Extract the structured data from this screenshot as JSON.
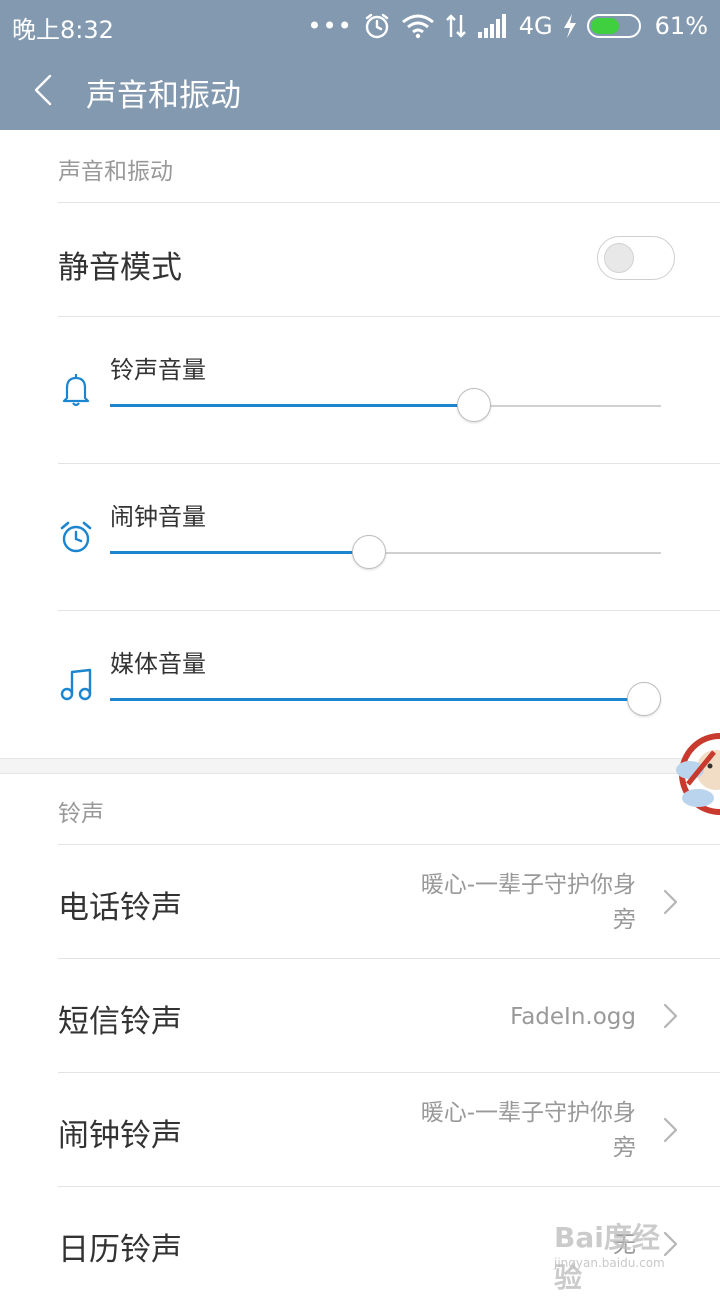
{
  "status_bar": {
    "time": "晚上8:32",
    "network": "4G",
    "battery": "61%",
    "battery_level": 0.61
  },
  "header": {
    "title": "声音和振动"
  },
  "sound_section": {
    "header": "声音和振动",
    "silent_mode": {
      "label": "静音模式",
      "enabled": false
    },
    "volumes": [
      {
        "label": "铃声音量",
        "icon": "bell-icon",
        "level": 0.66
      },
      {
        "label": "闹钟音量",
        "icon": "alarm-clock-icon",
        "level": 0.47
      },
      {
        "label": "媒体音量",
        "icon": "music-note-icon",
        "level": 0.97
      }
    ]
  },
  "ringtone_section": {
    "header": "铃声",
    "items": [
      {
        "label": "电话铃声",
        "value_line1": "暖心-一辈子守护你身",
        "value_line2": "旁"
      },
      {
        "label": "短信铃声",
        "value_line1": "FadeIn.ogg",
        "value_line2": ""
      },
      {
        "label": "闹钟铃声",
        "value_line1": "暖心-一辈子守护你身",
        "value_line2": "旁"
      },
      {
        "label": "日历铃声",
        "value_line1": "无",
        "value_line2": ""
      }
    ]
  },
  "watermark": {
    "brand": "Bai度经验",
    "url": "jingyan.baidu.com"
  },
  "colors": {
    "accent": "#1b85d0",
    "bar": "#8399b0"
  }
}
